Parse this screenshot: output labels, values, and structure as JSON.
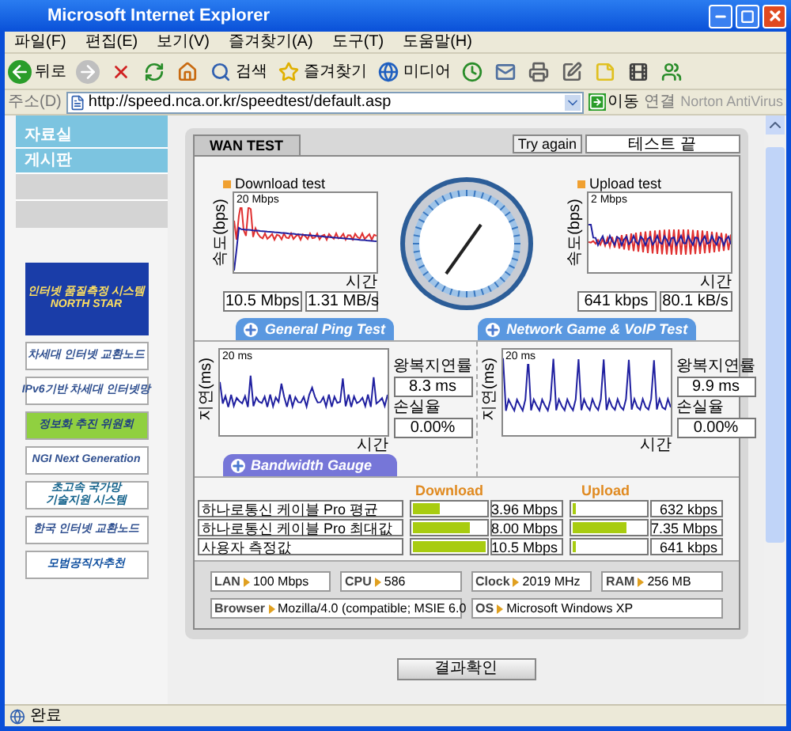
{
  "window": {
    "title": "Microsoft Internet Explorer"
  },
  "menu": [
    "파일(F)",
    "편집(E)",
    "보기(V)",
    "즐겨찾기(A)",
    "도구(T)",
    "도움말(H)"
  ],
  "toolbar": [
    {
      "kind": "back",
      "label": "뒤로"
    },
    {
      "kind": "forward"
    },
    {
      "kind": "stop"
    },
    {
      "kind": "refresh"
    },
    {
      "kind": "home"
    },
    {
      "kind": "search",
      "label": "검색"
    },
    {
      "kind": "favorites",
      "label": "즐겨찾기"
    },
    {
      "kind": "media",
      "label": "미디어"
    },
    {
      "kind": "history"
    },
    {
      "kind": "mail"
    },
    {
      "kind": "print"
    },
    {
      "kind": "edit"
    },
    {
      "kind": "note"
    },
    {
      "kind": "tool"
    },
    {
      "kind": "messenger"
    }
  ],
  "address": {
    "label": "주소(D)",
    "url": "http://speed.nca.or.kr/speedtest/default.asp",
    "go": "이동",
    "links": "연결",
    "plugin": "Norton AntiVirus"
  },
  "sidebar": {
    "items": [
      "자료실",
      "게시판"
    ],
    "banners": [
      {
        "kind": "globe",
        "lines": [
          "인터넷 품질측정 시스템",
          "NORTH STAR"
        ]
      },
      {
        "kind": "plain",
        "lines": [
          "차세대 인터넷 교환노드"
        ]
      },
      {
        "kind": "plain",
        "lines": [
          "IPv6기반 차세대 인터넷망"
        ]
      },
      {
        "kind": "green",
        "lines": [
          "정보화 추진 위원회"
        ]
      },
      {
        "kind": "plain",
        "lines": [
          "NGI Next Generation"
        ]
      },
      {
        "kind": "teal",
        "lines": [
          "초고속 국가망",
          "기술지원 시스템"
        ]
      },
      {
        "kind": "plain",
        "lines": [
          "한국 인터넷 교환노드"
        ]
      },
      {
        "kind": "pink",
        "lines": [
          "모범공직자추천"
        ]
      }
    ]
  },
  "wan_test": {
    "tab": "WAN TEST",
    "try_again": "Try again",
    "status": "테스트 끝",
    "download": {
      "title": "Download test",
      "ylabel": "속도(bps)",
      "scale": "20 Mbps",
      "xlabel": "시간",
      "readings": [
        "10.5 Mbps",
        "1.31 MB/s"
      ]
    },
    "upload": {
      "title": "Upload test",
      "ylabel": "속도(bps)",
      "scale": "2 Mbps",
      "xlabel": "시간",
      "readings": [
        "641 kbps",
        "80.1 kB/s"
      ]
    },
    "ping_tabs": [
      "General Ping Test",
      "Network Game & VoIP Test"
    ],
    "pings": [
      {
        "ylabel": "지연(ms)",
        "scale": "20 ms",
        "xlabel": "시간",
        "rtt_label": "왕복지연률",
        "rtt": "8.3 ms",
        "loss_label": "손실율",
        "loss": "0.00%"
      },
      {
        "ylabel": "지연(ms)",
        "scale": "20 ms",
        "xlabel": "시간",
        "rtt_label": "왕복지연률",
        "rtt": "9.9 ms",
        "loss_label": "손실율",
        "loss": "0.00%"
      }
    ],
    "bandwidth": {
      "tab": "Bandwidth Gauge",
      "download": "Download",
      "upload": "Upload",
      "rows": [
        {
          "name": "하나로통신 케이블 Pro 평균",
          "download": {
            "level": 0.38,
            "reading": "3.96 Mbps"
          },
          "upload": {
            "level": 0.05,
            "reading": "632 kbps"
          }
        },
        {
          "name": "하나로통신 케이블 Pro 최대값",
          "download": {
            "level": 0.8,
            "reading": "8.00 Mbps"
          },
          "upload": {
            "level": 0.75,
            "reading": "7.35 Mbps"
          }
        },
        {
          "name": "사용자 측정값",
          "download": {
            "level": 1,
            "reading": "10.5 Mbps"
          },
          "upload": {
            "level": 0.05,
            "reading": "641 kbps"
          }
        }
      ]
    },
    "system": [
      {
        "label": "LAN",
        "value": "100 Mbps"
      },
      {
        "label": "CPU",
        "value": "586"
      },
      {
        "label": "Clock",
        "value": "2019 MHz"
      },
      {
        "label": "RAM",
        "value": "256 MB"
      },
      {
        "label": "Browser",
        "value": "Mozilla/4.0 (compatible; MSIE 6.0"
      },
      {
        "label": "OS",
        "value": "Microsoft Windows XP"
      }
    ]
  },
  "result_button": "결과확인",
  "status_bar": {
    "text": "완료"
  }
}
